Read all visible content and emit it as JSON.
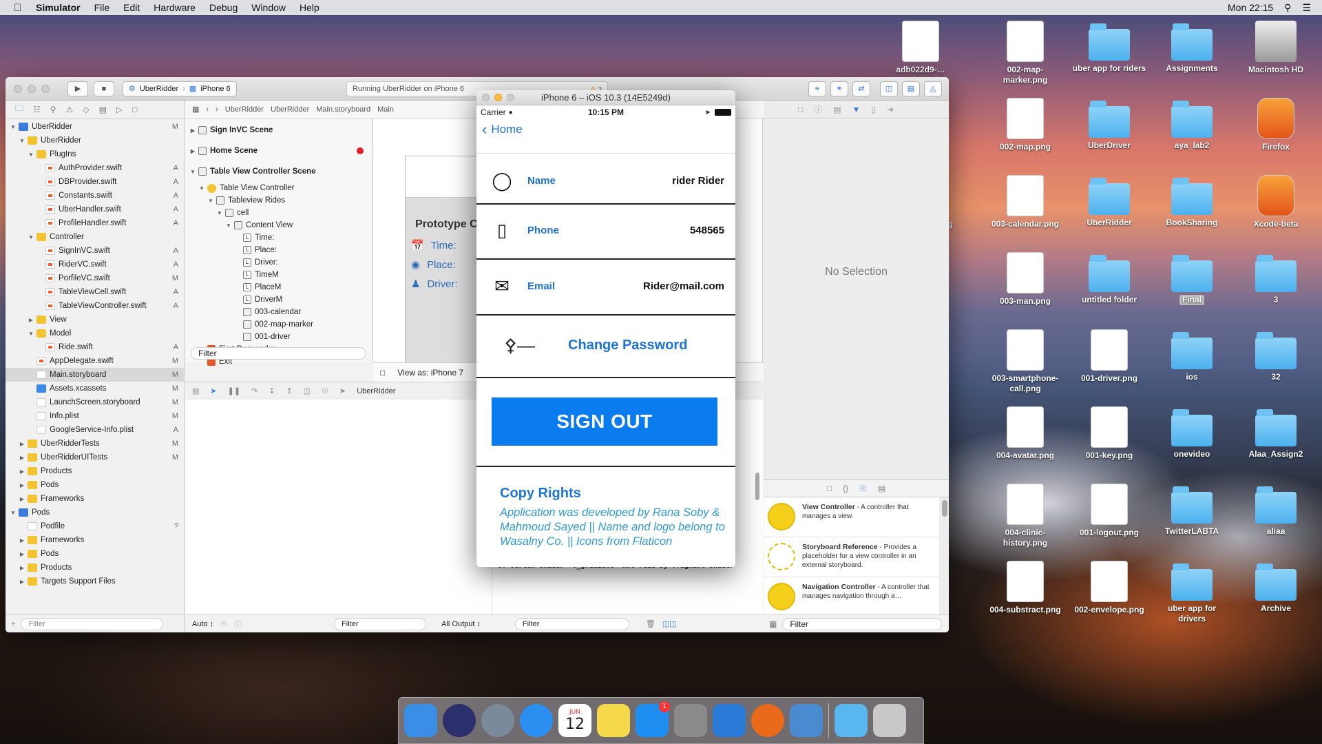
{
  "menubar": {
    "app": "Simulator",
    "items": [
      "File",
      "Edit",
      "Hardware",
      "Debug",
      "Window",
      "Help"
    ],
    "clock": "Mon 22:15"
  },
  "desktop": {
    "icons": [
      {
        "label": "adb022d9-…a3.png",
        "kind": "file"
      },
      {
        "label": "002-map-marker.png",
        "kind": "file"
      },
      {
        "label": "uber app for riders",
        "kind": "folder"
      },
      {
        "label": "Assignments",
        "kind": "folder"
      },
      {
        "label": "Macintosh HD",
        "kind": "disk"
      },
      {
        "label": "…png",
        "kind": "file"
      },
      {
        "label": "002-map.png",
        "kind": "file"
      },
      {
        "label": "UberDriver",
        "kind": "folder"
      },
      {
        "label": "aya_lab2",
        "kind": "folder"
      },
      {
        "label": "Firefox",
        "kind": "app"
      },
      {
        "label": "Screen… 29.png",
        "kind": "file"
      },
      {
        "label": "003-calendar.png",
        "kind": "file"
      },
      {
        "label": "UberRidder",
        "kind": "folder"
      },
      {
        "label": "BookSharing",
        "kind": "folder"
      },
      {
        "label": "Xcode-beta",
        "kind": "app"
      },
      {
        "label": "…t.png",
        "kind": "file"
      },
      {
        "label": "003-man.png",
        "kind": "file"
      },
      {
        "label": "untitled folder",
        "kind": "folder"
      },
      {
        "label": "Final",
        "kind": "folder"
      },
      {
        "label": "3",
        "kind": "folder"
      },
      {
        "label": "rvice-…list",
        "kind": "file"
      },
      {
        "label": "003-smartphone-call.png",
        "kind": "file"
      },
      {
        "label": "001-driver.png",
        "kind": "file"
      },
      {
        "label": "ios",
        "kind": "folder"
      },
      {
        "label": "32",
        "kind": "folder"
      },
      {
        "label": "ew.swif",
        "kind": "file"
      },
      {
        "label": "004-avatar.png",
        "kind": "file"
      },
      {
        "label": "001-key.png",
        "kind": "file"
      },
      {
        "label": "onevideo",
        "kind": "folder"
      },
      {
        "label": "Alaa_Assign2",
        "kind": "folder"
      },
      {
        "label": "ent.play…nd",
        "kind": "file"
      },
      {
        "label": "004-clinic-history.png",
        "kind": "file"
      },
      {
        "label": "001-logout.png",
        "kind": "file"
      },
      {
        "label": "TwitterLABTA",
        "kind": "folder"
      },
      {
        "label": "aliaa",
        "kind": "folder"
      },
      {
        "label": "round",
        "kind": "file"
      },
      {
        "label": "004-substract.png",
        "kind": "file"
      },
      {
        "label": "002-envelope.png",
        "kind": "file"
      },
      {
        "label": "uber app for drivers",
        "kind": "folder"
      },
      {
        "label": "Archive",
        "kind": "folder"
      }
    ]
  },
  "xcode": {
    "scheme": "UberRidder",
    "device": "iPhone 6",
    "status": "Running UberRidder on iPhone 6",
    "warnings": "2",
    "breadcrumb": [
      "UberRidder",
      "UberRidder",
      "Main.storyboard",
      "Main"
    ],
    "navigator": [
      {
        "label": "UberRidder",
        "depth": 0,
        "type": "proj",
        "badge": "M",
        "arrow": "▼"
      },
      {
        "label": "UberRidder",
        "depth": 1,
        "type": "fold",
        "badge": "",
        "arrow": "▼"
      },
      {
        "label": "PlugIns",
        "depth": 2,
        "type": "fold",
        "badge": "",
        "arrow": "▼"
      },
      {
        "label": "AuthProvider.swift",
        "depth": 3,
        "type": "swift",
        "badge": "A",
        "arrow": ""
      },
      {
        "label": "DBProvider.swift",
        "depth": 3,
        "type": "swift",
        "badge": "A",
        "arrow": ""
      },
      {
        "label": "Constants.swift",
        "depth": 3,
        "type": "swift",
        "badge": "A",
        "arrow": ""
      },
      {
        "label": "UberHandler.swift",
        "depth": 3,
        "type": "swift",
        "badge": "A",
        "arrow": ""
      },
      {
        "label": "ProfileHandler.swift",
        "depth": 3,
        "type": "swift",
        "badge": "A",
        "arrow": ""
      },
      {
        "label": "Controller",
        "depth": 2,
        "type": "fold",
        "badge": "",
        "arrow": "▼"
      },
      {
        "label": "SignInVC.swift",
        "depth": 3,
        "type": "swift",
        "badge": "A",
        "arrow": ""
      },
      {
        "label": "RiderVC.swift",
        "depth": 3,
        "type": "swift",
        "badge": "A",
        "arrow": ""
      },
      {
        "label": "PorfileVC.swift",
        "depth": 3,
        "type": "swift",
        "badge": "M",
        "arrow": ""
      },
      {
        "label": "TableViewCell.swift",
        "depth": 3,
        "type": "swift",
        "badge": "A",
        "arrow": ""
      },
      {
        "label": "TableViewController.swift",
        "depth": 3,
        "type": "swift",
        "badge": "A",
        "arrow": ""
      },
      {
        "label": "View",
        "depth": 2,
        "type": "fold",
        "badge": "",
        "arrow": "▶"
      },
      {
        "label": "Model",
        "depth": 2,
        "type": "fold",
        "badge": "",
        "arrow": "▼"
      },
      {
        "label": "Ride.swift",
        "depth": 3,
        "type": "swift",
        "badge": "A",
        "arrow": ""
      },
      {
        "label": "AppDelegate.swift",
        "depth": 2,
        "type": "swift",
        "badge": "M",
        "arrow": ""
      },
      {
        "label": "Main.storyboard",
        "depth": 2,
        "type": "sb",
        "badge": "M",
        "arrow": "",
        "sel": true
      },
      {
        "label": "Assets.xcassets",
        "depth": 2,
        "type": "blue",
        "badge": "M",
        "arrow": ""
      },
      {
        "label": "LaunchScreen.storyboard",
        "depth": 2,
        "type": "sb",
        "badge": "M",
        "arrow": ""
      },
      {
        "label": "Info.plist",
        "depth": 2,
        "type": "sb",
        "badge": "M",
        "arrow": ""
      },
      {
        "label": "GoogleService-Info.plist",
        "depth": 2,
        "type": "sb",
        "badge": "A",
        "arrow": ""
      },
      {
        "label": "UberRidderTests",
        "depth": 1,
        "type": "fold",
        "badge": "M",
        "arrow": "▶"
      },
      {
        "label": "UberRidderUITests",
        "depth": 1,
        "type": "fold",
        "badge": "M",
        "arrow": "▶"
      },
      {
        "label": "Products",
        "depth": 1,
        "type": "fold",
        "badge": "",
        "arrow": "▶"
      },
      {
        "label": "Pods",
        "depth": 1,
        "type": "fold",
        "badge": "",
        "arrow": "▶"
      },
      {
        "label": "Frameworks",
        "depth": 1,
        "type": "fold",
        "badge": "",
        "arrow": "▶"
      },
      {
        "label": "Pods",
        "depth": 0,
        "type": "proj",
        "badge": "",
        "arrow": "▼"
      },
      {
        "label": "Podfile",
        "depth": 1,
        "type": "sb",
        "badge": "?",
        "arrow": ""
      },
      {
        "label": "Frameworks",
        "depth": 1,
        "type": "fold",
        "badge": "",
        "arrow": "▶"
      },
      {
        "label": "Pods",
        "depth": 1,
        "type": "fold",
        "badge": "",
        "arrow": "▶"
      },
      {
        "label": "Products",
        "depth": 1,
        "type": "fold",
        "badge": "",
        "arrow": "▶"
      },
      {
        "label": "Targets Support Files",
        "depth": 1,
        "type": "fold",
        "badge": "",
        "arrow": "▶"
      }
    ],
    "outline": [
      {
        "label": "Sign InVC Scene",
        "depth": 0,
        "type": "scn",
        "arrow": "▶",
        "scene": true
      },
      {
        "label": "Home Scene",
        "depth": 0,
        "type": "scn",
        "arrow": "▶",
        "scene": true,
        "error": true
      },
      {
        "label": "Table View Controller Scene",
        "depth": 0,
        "type": "scn",
        "arrow": "▼",
        "scene": true
      },
      {
        "label": "Table View Controller",
        "depth": 1,
        "type": "vc",
        "arrow": "▼"
      },
      {
        "label": "Tableview Rides",
        "depth": 2,
        "type": "scn",
        "arrow": "▼"
      },
      {
        "label": "cell",
        "depth": 3,
        "type": "scn",
        "arrow": "▼"
      },
      {
        "label": "Content View",
        "depth": 4,
        "type": "scn",
        "arrow": "▼"
      },
      {
        "label": "Time:",
        "depth": 5,
        "type": "lbl",
        "arrow": ""
      },
      {
        "label": "Place:",
        "depth": 5,
        "type": "lbl",
        "arrow": ""
      },
      {
        "label": "Driver:",
        "depth": 5,
        "type": "lbl",
        "arrow": ""
      },
      {
        "label": "TimeM",
        "depth": 5,
        "type": "lbl",
        "arrow": ""
      },
      {
        "label": "PlaceM",
        "depth": 5,
        "type": "lbl",
        "arrow": ""
      },
      {
        "label": "DriverM",
        "depth": 5,
        "type": "lbl",
        "arrow": ""
      },
      {
        "label": "003-calendar",
        "depth": 5,
        "type": "scn",
        "arrow": ""
      },
      {
        "label": "002-map-marker",
        "depth": 5,
        "type": "scn",
        "arrow": ""
      },
      {
        "label": "001-driver",
        "depth": 5,
        "type": "scn",
        "arrow": ""
      },
      {
        "label": "First Responder",
        "depth": 1,
        "type": "red",
        "arrow": ""
      },
      {
        "label": "Exit",
        "depth": 1,
        "type": "red",
        "arrow": ""
      }
    ],
    "filter_placeholder": "Filter",
    "prototype": {
      "title": "Prototype C",
      "time": "Time:",
      "place": "Place:",
      "driver": "Driver:"
    },
    "view_as": "View as: iPhone 7",
    "debug_target": "UberRidder",
    "console_text": "of vertex shader 'v_gradient' not read by fragment shader",
    "auto_label": "Auto ↕",
    "output_label": "All Output ↕",
    "no_selection": "No Selection",
    "library": [
      {
        "title": "View Controller",
        "desc": " - A controller that manages a view."
      },
      {
        "title": "Storyboard Reference",
        "desc": " - Provides a placeholder for a view controller in an external storyboard."
      },
      {
        "title": "Navigation Controller",
        "desc": " - A controller that manages navigation through a…"
      }
    ]
  },
  "simulator": {
    "title": "iPhone 6 – iOS 10.3 (14E5249d)",
    "carrier": "Carrier",
    "time": "10:15 PM",
    "back": "Home",
    "rows": [
      {
        "icon": "avatar-icon",
        "glyph": "👤",
        "label": "Name",
        "value": "rider Rider"
      },
      {
        "icon": "smartphone-icon",
        "glyph": "📱",
        "label": "Phone",
        "value": "548565"
      },
      {
        "icon": "envelope-icon",
        "glyph": "✉",
        "label": "Email",
        "value": "Rider@mail.com"
      }
    ],
    "change_password": "Change Password",
    "sign_out": "SIGN OUT",
    "copy_title": "Copy Rights",
    "copy_body": "Application was developed by Rana Soby & Mahmoud Sayed || Name and logo belong to Wasalny Co. || Icons from Flaticon"
  },
  "dock": {
    "apps": [
      {
        "name": "Finder",
        "color": "#3a8ee6"
      },
      {
        "name": "Siri",
        "color": "#2b2f6b"
      },
      {
        "name": "Launchpad",
        "color": "#7a8a9a"
      },
      {
        "name": "Safari",
        "color": "#2a8ff0"
      },
      {
        "name": "Calendar",
        "color": "#ffffff"
      },
      {
        "name": "Notes",
        "color": "#f6d94a"
      },
      {
        "name": "App Store",
        "color": "#1e8ef0",
        "badge": "1"
      },
      {
        "name": "System Preferences",
        "color": "#8a8a8a"
      },
      {
        "name": "Xcode",
        "color": "#2a7ad8"
      },
      {
        "name": "Firefox",
        "color": "#e86a1a"
      },
      {
        "name": "Xcode-beta",
        "color": "#4a8ad0"
      },
      {
        "name": "Downloads",
        "color": "#5ab6ef"
      },
      {
        "name": "Trash",
        "color": "#c8c8c8"
      }
    ],
    "calendar_month": "JUN",
    "calendar_day": "12"
  }
}
